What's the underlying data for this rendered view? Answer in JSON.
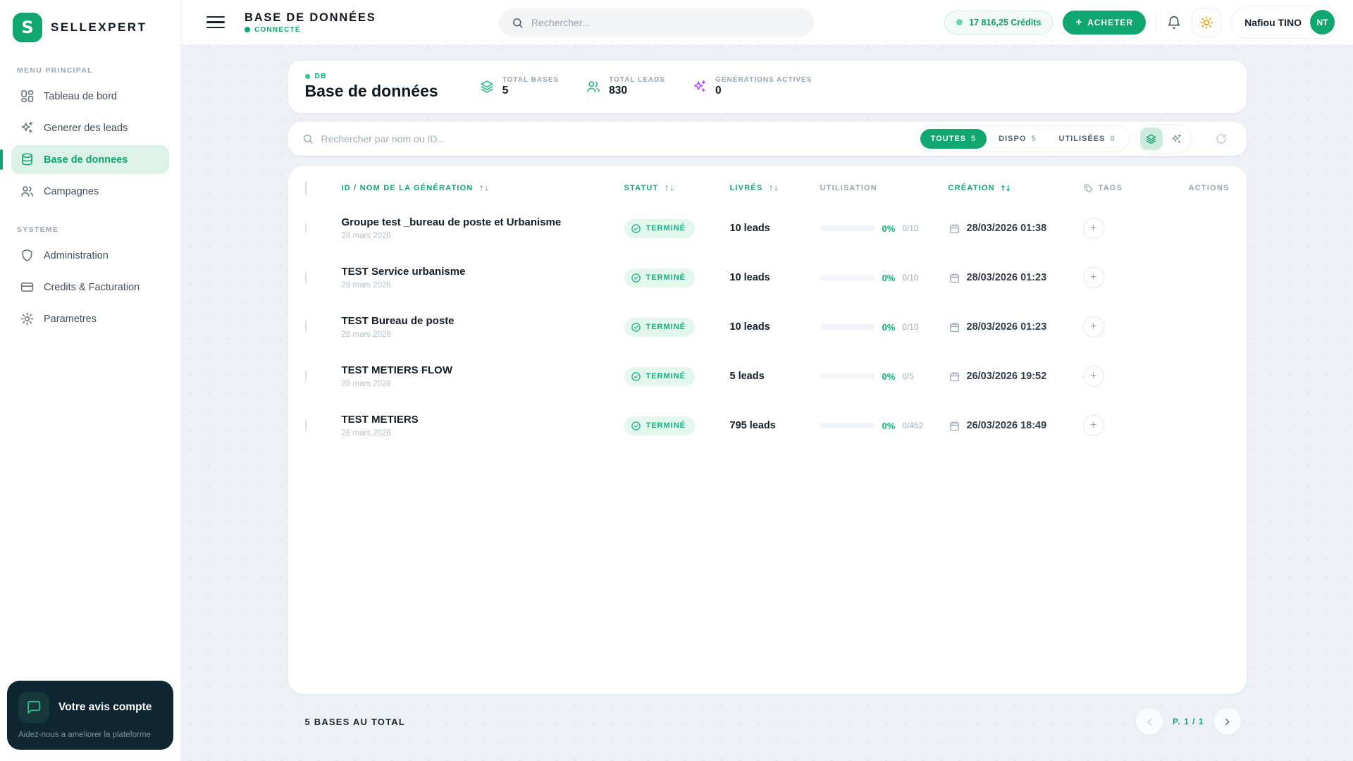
{
  "colors": {
    "accent": "#10a66f",
    "accent_light": "#dcf2e7",
    "status_green": "#10b27c",
    "purple": "#a855f7",
    "dark_card": "#0d2631",
    "sun_orange": "#f59e0b"
  },
  "sidebar": {
    "brand": "SELLEXPERT",
    "logo_letter": "S",
    "sections": [
      {
        "label": "MENU PRINCIPAL",
        "items": [
          {
            "label": "Tableau de bord",
            "icon": "dashboard-icon",
            "active": false
          },
          {
            "label": "Generer des leads",
            "icon": "sparkles-icon",
            "active": false
          },
          {
            "label": "Base de donnees",
            "icon": "database-icon",
            "active": true
          },
          {
            "label": "Campagnes",
            "icon": "users-icon",
            "active": false
          }
        ]
      },
      {
        "label": "SYSTEME",
        "items": [
          {
            "label": "Administration",
            "icon": "shield-icon",
            "active": false
          },
          {
            "label": "Credits & Facturation",
            "icon": "credit-card-icon",
            "active": false
          },
          {
            "label": "Parametres",
            "icon": "gear-icon",
            "active": false
          }
        ]
      }
    ],
    "feedback": {
      "title": "Votre avis compte",
      "subtitle": "Aidez-nous a ameliorer la plateforme"
    }
  },
  "topbar": {
    "title": "BASE DE DONNÉES",
    "status": "CONNECTÉ",
    "search_placeholder": "Rechercher...",
    "credits": "17 816,25 Crédits",
    "buy_label": "ACHETER",
    "buy_plus": "+",
    "user": {
      "name": "Nafiou TINO",
      "initials": "NT"
    }
  },
  "page": {
    "badge": "DB",
    "title": "Base de données",
    "stats": [
      {
        "label": "TOTAL BASES",
        "value": "5",
        "icon": "layers-icon"
      },
      {
        "label": "TOTAL LEADS",
        "value": "830",
        "icon": "users-icon"
      },
      {
        "label": "GÉNÉRATIONS ACTIVES",
        "value": "0",
        "icon": "sparkles-icon"
      }
    ]
  },
  "filters": {
    "search_placeholder": "Rechercher par nom ou ID...",
    "tabs": [
      {
        "label": "TOUTES",
        "count": "5",
        "active": true
      },
      {
        "label": "DISPO",
        "count": "5",
        "active": false
      },
      {
        "label": "UTILISÉES",
        "count": "0",
        "active": false
      }
    ]
  },
  "table": {
    "columns": {
      "name": "ID / NOM DE LA GÉNÉRATION",
      "status": "STATUT",
      "delivered": "LIVRÉS",
      "usage": "UTILISATION",
      "created": "CRÉATION",
      "tags": "TAGS",
      "actions": "ACTIONS"
    },
    "rows": [
      {
        "name": "Groupe test _bureau de poste et Urbanisme",
        "date": "28 mars 2026",
        "status": "TERMINÉ",
        "leads": "10 leads",
        "percent": "0%",
        "ratio": "0/10",
        "created": "28/03/2026 01:38"
      },
      {
        "name": "TEST Service urbanisme",
        "date": "28 mars 2026",
        "status": "TERMINÉ",
        "leads": "10 leads",
        "percent": "0%",
        "ratio": "0/10",
        "created": "28/03/2026 01:23"
      },
      {
        "name": "TEST Bureau de poste",
        "date": "28 mars 2026",
        "status": "TERMINÉ",
        "leads": "10 leads",
        "percent": "0%",
        "ratio": "0/10",
        "created": "28/03/2026 01:23"
      },
      {
        "name": "TEST METIERS FLOW",
        "date": "26 mars 2026",
        "status": "TERMINÉ",
        "leads": "5 leads",
        "percent": "0%",
        "ratio": "0/5",
        "created": "26/03/2026 19:52"
      },
      {
        "name": "TEST METIERS",
        "date": "26 mars 2026",
        "status": "TERMINÉ",
        "leads": "795 leads",
        "percent": "0%",
        "ratio": "0/452",
        "created": "26/03/2026 18:49"
      }
    ],
    "add_tag_label": "+"
  },
  "footer": {
    "total": "5 BASES AU TOTAL",
    "page_indicator": "P. 1 / 1"
  }
}
